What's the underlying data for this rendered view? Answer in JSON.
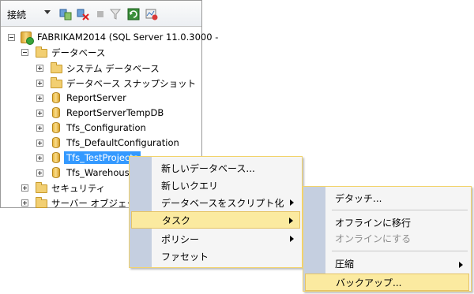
{
  "toolbar": {
    "connect_label": "接続",
    "icons": [
      "connect-object-icon",
      "disconnect-icon",
      "stop-icon",
      "filter-icon",
      "refresh-icon",
      "activity-monitor-icon"
    ]
  },
  "tree": {
    "server": "FABRIKAM2014 (SQL Server 11.0.3000 -",
    "databases_folder": "データベース",
    "items": [
      {
        "label": "システム データベース",
        "type": "folder"
      },
      {
        "label": "データベース スナップショット",
        "type": "folder"
      },
      {
        "label": "ReportServer",
        "type": "db"
      },
      {
        "label": "ReportServerTempDB",
        "type": "db"
      },
      {
        "label": "Tfs_Configuration",
        "type": "db"
      },
      {
        "label": "Tfs_DefaultConfiguration",
        "type": "db"
      },
      {
        "label": "Tfs_TestProjects",
        "type": "db",
        "selected": true
      },
      {
        "label": "Tfs_Warehouse",
        "type": "db"
      }
    ],
    "security_folder": "セキュリティ",
    "server_objects_folder": "サーバー オブジェクト"
  },
  "context_menu": {
    "new_database": "新しいデータベース...",
    "new_query": "新しいクエリ",
    "script_database": "データベースをスクリプト化",
    "tasks": "タスク",
    "policies": "ポリシー",
    "facets": "ファセット"
  },
  "tasks_submenu": {
    "detach": "デタッチ...",
    "take_offline": "オフラインに移行",
    "bring_online": "オンラインにする",
    "shrink": "圧縮",
    "backup": "バックアップ..."
  },
  "colors": {
    "selection": "#3399ff",
    "menu_highlight": "#fbeaa0",
    "menu_border": "#f2d36b",
    "menu_gutter": "#c5cfe0"
  }
}
